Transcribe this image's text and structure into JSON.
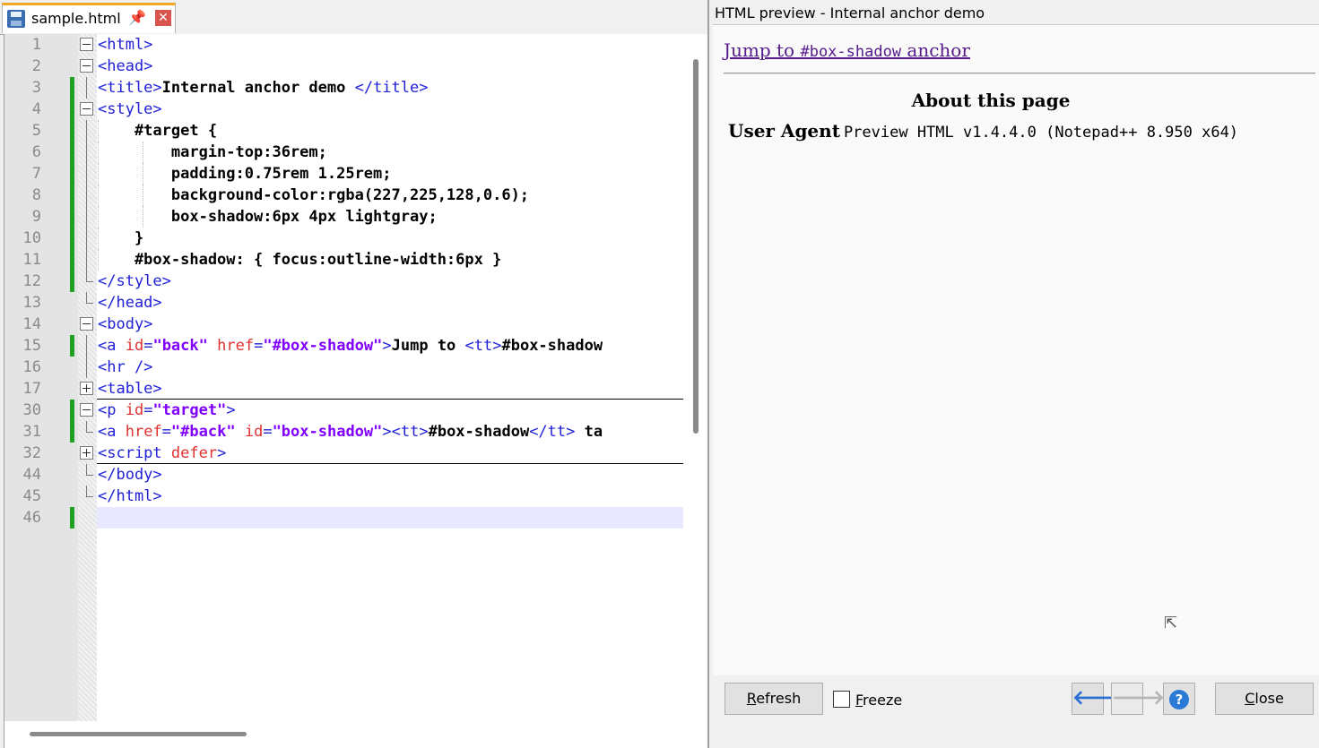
{
  "editor": {
    "tab": {
      "filename": "sample.html",
      "icons": [
        "save-icon",
        "pin-icon",
        "close-icon"
      ]
    },
    "current_line_number": "46",
    "lines": [
      {
        "num": "1",
        "tokens": [
          [
            "tag",
            "<html>"
          ]
        ]
      },
      {
        "num": "2",
        "tokens": [
          [
            "tag",
            "<head>"
          ]
        ]
      },
      {
        "num": "3",
        "tokens": [
          [
            "tag",
            "<title>"
          ],
          [
            "text",
            "Internal anchor demo "
          ],
          [
            "tag",
            "</title>"
          ]
        ]
      },
      {
        "num": "4",
        "tokens": [
          [
            "tag",
            "<style>"
          ]
        ]
      },
      {
        "num": "5",
        "tokens": [
          [
            "css",
            "    #target {"
          ]
        ]
      },
      {
        "num": "6",
        "tokens": [
          [
            "css",
            "        margin-top:36rem;"
          ]
        ]
      },
      {
        "num": "7",
        "tokens": [
          [
            "css",
            "        padding:0.75rem 1.25rem;"
          ]
        ]
      },
      {
        "num": "8",
        "tokens": [
          [
            "css",
            "        background-color:rgba(227,225,128,0.6);"
          ]
        ]
      },
      {
        "num": "9",
        "tokens": [
          [
            "css",
            "        box-shadow:6px 4px lightgray;"
          ]
        ]
      },
      {
        "num": "10",
        "tokens": [
          [
            "css",
            "    }"
          ]
        ]
      },
      {
        "num": "11",
        "tokens": [
          [
            "css",
            "    #box-shadow: { focus:outline-width:6px }"
          ]
        ]
      },
      {
        "num": "12",
        "tokens": [
          [
            "tag",
            "</style>"
          ]
        ]
      },
      {
        "num": "13",
        "tokens": [
          [
            "tag",
            "</head>"
          ]
        ]
      },
      {
        "num": "14",
        "tokens": [
          [
            "tag",
            "<body>"
          ]
        ]
      },
      {
        "num": "15",
        "tokens": [
          [
            "tag",
            "<a "
          ],
          [
            "attr",
            "id"
          ],
          [
            "tag",
            "="
          ],
          [
            "val",
            "\"back\""
          ],
          [
            "tag",
            " "
          ],
          [
            "attr",
            "href"
          ],
          [
            "tag",
            "="
          ],
          [
            "val",
            "\"#box-shadow\""
          ],
          [
            "tag",
            ">"
          ],
          [
            "text",
            "Jump to "
          ],
          [
            "tag",
            "<tt>"
          ],
          [
            "text",
            "#box-shadow"
          ]
        ]
      },
      {
        "num": "16",
        "tokens": [
          [
            "tag",
            "<hr />"
          ]
        ]
      },
      {
        "num": "17",
        "tokens": [
          [
            "tag",
            "<table>"
          ]
        ]
      },
      {
        "num": "30",
        "tokens": [
          [
            "tag",
            "<p "
          ],
          [
            "attr",
            "id"
          ],
          [
            "tag",
            "="
          ],
          [
            "val",
            "\"target\""
          ],
          [
            "tag",
            ">"
          ]
        ]
      },
      {
        "num": "31",
        "tokens": [
          [
            "tag",
            "<a "
          ],
          [
            "attr",
            "href"
          ],
          [
            "tag",
            "="
          ],
          [
            "val",
            "\"#back\""
          ],
          [
            "tag",
            " "
          ],
          [
            "attr",
            "id"
          ],
          [
            "tag",
            "="
          ],
          [
            "val",
            "\"box-shadow\""
          ],
          [
            "tag",
            ">"
          ],
          [
            "tag",
            "<tt>"
          ],
          [
            "text",
            "#box-shadow"
          ],
          [
            "tag",
            "</tt>"
          ],
          [
            "text",
            " ta"
          ]
        ]
      },
      {
        "num": "32",
        "tokens": [
          [
            "tag",
            "<script "
          ],
          [
            "attr",
            "defer"
          ],
          [
            "tag",
            ">"
          ]
        ]
      },
      {
        "num": "44",
        "tokens": [
          [
            "tag",
            "</body>"
          ]
        ]
      },
      {
        "num": "45",
        "tokens": [
          [
            "tag",
            "</html>"
          ]
        ]
      },
      {
        "num": "46",
        "tokens": []
      }
    ]
  },
  "preview": {
    "window_title": "HTML preview - Internal anchor demo",
    "link_prefix": "Jump to ",
    "link_code": "#box-shadow",
    "link_suffix": " anchor",
    "caption": "About this page",
    "row_header": "User Agent",
    "row_value": "Preview HTML v1.4.4.0 (Notepad++ 8.950 x64)",
    "buttons": {
      "refresh_first": "R",
      "refresh_rest": "efresh",
      "freeze_first": "F",
      "freeze_rest": "reeze",
      "close_first": "C",
      "close_rest": "lose",
      "back_glyph": "🡐",
      "forward_glyph": "🡒",
      "help_glyph": "?"
    },
    "freeze_checked": false
  },
  "colors": {
    "tag": "#2121d8",
    "attr": "#e03030",
    "value": "#8000ff",
    "accent_tab": "#f5a623",
    "change_marker": "#1fa01f",
    "link": "#551a8b"
  }
}
